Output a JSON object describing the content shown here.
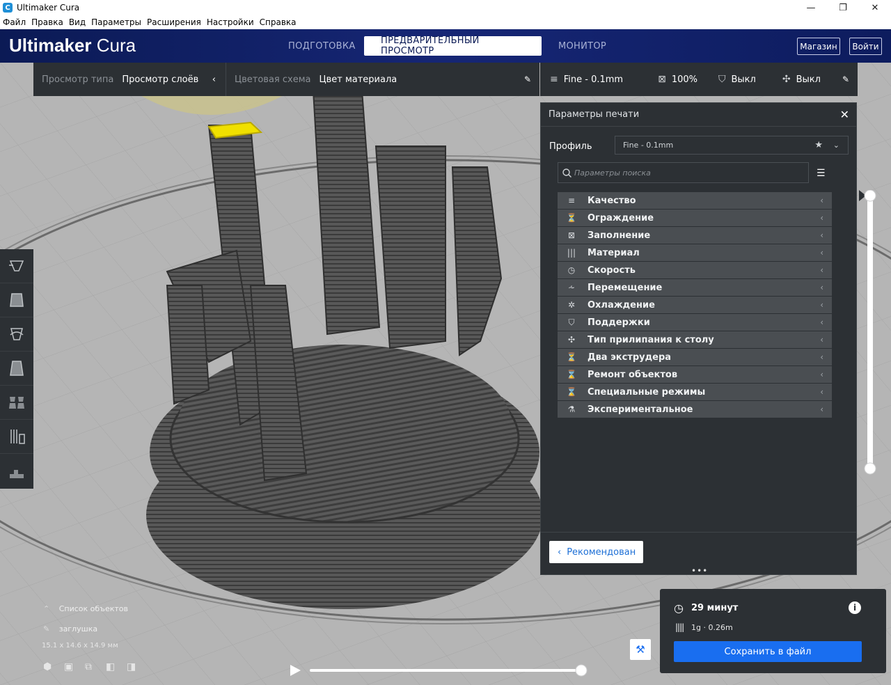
{
  "window": {
    "title": "Ultimaker Cura",
    "controls": [
      "—",
      "❐",
      "✕"
    ]
  },
  "menu": [
    "Файл",
    "Правка",
    "Вид",
    "Параметры",
    "Расширения",
    "Настройки",
    "Справка"
  ],
  "header": {
    "brand_bold": "Ultimaker",
    "brand_light": "Cura",
    "tabs": [
      {
        "label": "ПОДГОТОВКА",
        "active": false
      },
      {
        "label": "ПРЕДВАРИТЕЛЬНЫЙ ПРОСМОТР",
        "active": true
      },
      {
        "label": "МОНИТОР",
        "active": false
      }
    ],
    "marketplace_label": "Магазин",
    "signin_label": "Войти"
  },
  "viewbar": {
    "view_type_label": "Просмотр типа",
    "view_type_value": "Просмотр слоёв",
    "color_scheme_label": "Цветовая схема",
    "color_scheme_value": "Цвет материала"
  },
  "printbar": {
    "profile": "Fine - 0.1mm",
    "infill": "100%",
    "support": "Выкл",
    "adhesion": "Выкл"
  },
  "panel": {
    "title": "Параметры печати",
    "profile_label": "Профиль",
    "profile_value": "Fine - 0.1mm",
    "search_placeholder": "Параметры поиска",
    "categories": [
      {
        "label": "Качество",
        "icon": "quality-icon"
      },
      {
        "label": "Ограждение",
        "icon": "shell-icon"
      },
      {
        "label": "Заполнение",
        "icon": "infill-icon"
      },
      {
        "label": "Материал",
        "icon": "material-icon"
      },
      {
        "label": "Скорость",
        "icon": "speed-icon"
      },
      {
        "label": "Перемещение",
        "icon": "travel-icon"
      },
      {
        "label": "Охлаждение",
        "icon": "cooling-icon"
      },
      {
        "label": "Поддержки",
        "icon": "support-icon"
      },
      {
        "label": "Тип прилипания к столу",
        "icon": "adhesion-icon"
      },
      {
        "label": "Два экструдера",
        "icon": "dual-extruder-icon"
      },
      {
        "label": "Ремонт объектов",
        "icon": "mesh-fix-icon"
      },
      {
        "label": "Специальные режимы",
        "icon": "special-modes-icon"
      },
      {
        "label": "Экспериментальное",
        "icon": "experimental-icon"
      }
    ],
    "recommended_label": "Рекомендован"
  },
  "objects": {
    "list_label": "Список объектов",
    "object_name": "заглушка",
    "dimensions": "15.1 x 14.6 x 14.9 мм"
  },
  "job": {
    "time": "29 минут",
    "material": "1g · 0.26m",
    "save_label": "Сохранить в файл"
  },
  "colors": {
    "header": "#0b1a55",
    "panel": "#2c3034",
    "accent": "#196ef0",
    "model": "#4a4a4a",
    "current_layer": "#f0e000"
  }
}
